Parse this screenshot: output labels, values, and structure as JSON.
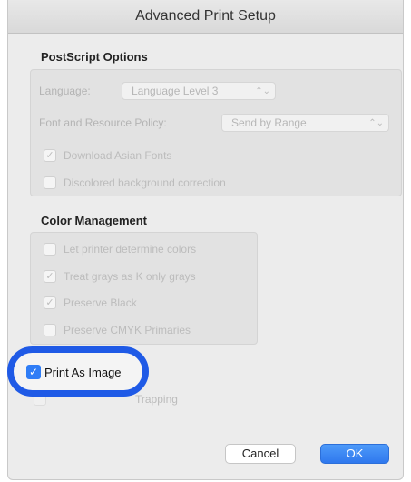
{
  "window": {
    "title": "Advanced Print Setup"
  },
  "postscript": {
    "title": "PostScript Options",
    "language_label": "Language:",
    "language_value": "Language Level 3",
    "font_policy_label": "Font and Resource Policy:",
    "font_policy_value": "Send by Range",
    "download_asian": {
      "label": "Download Asian Fonts",
      "checked": true
    },
    "discolored_bg": {
      "label": "Discolored background correction",
      "checked": false
    }
  },
  "color": {
    "title": "Color Management",
    "items": [
      {
        "label": "Let printer determine colors",
        "checked": false
      },
      {
        "label": "Treat grays as K only grays",
        "checked": true
      },
      {
        "label": "Preserve Black",
        "checked": true
      },
      {
        "label": "Preserve CMYK Primaries",
        "checked": false
      }
    ]
  },
  "print_as_image": {
    "label": "Print As Image",
    "checked": true
  },
  "trapping_label": "Trapping",
  "buttons": {
    "cancel": "Cancel",
    "ok": "OK"
  },
  "colors": {
    "accent": "#1f5ae6",
    "checkbox": "#2f7df6"
  }
}
